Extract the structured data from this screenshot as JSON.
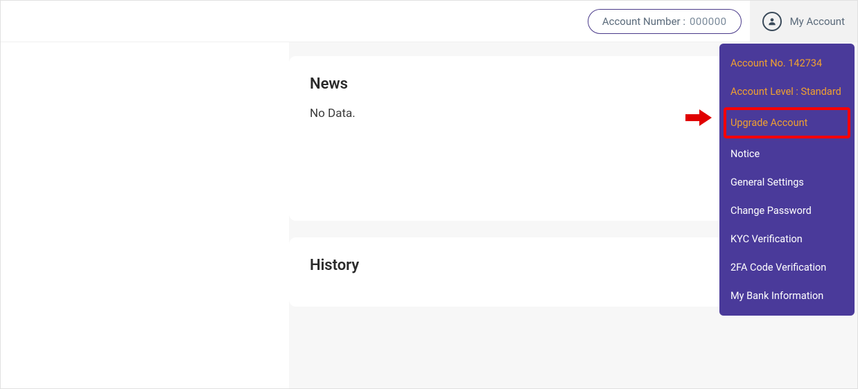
{
  "header": {
    "account_number_label": "Account Number :",
    "account_number_value": "000000",
    "my_account_label": "My Account"
  },
  "cards": {
    "news": {
      "title": "News",
      "body": "No Data."
    },
    "history": {
      "title": "History"
    }
  },
  "menu": {
    "account_no": "Account No. 142734",
    "account_level": "Account Level : Standard",
    "upgrade": "Upgrade Account",
    "notice": "Notice",
    "general_settings": "General Settings",
    "change_password": "Change Password",
    "kyc": "KYC Verification",
    "two_fa": "2FA Code Verification",
    "bank_info": "My Bank Information"
  }
}
